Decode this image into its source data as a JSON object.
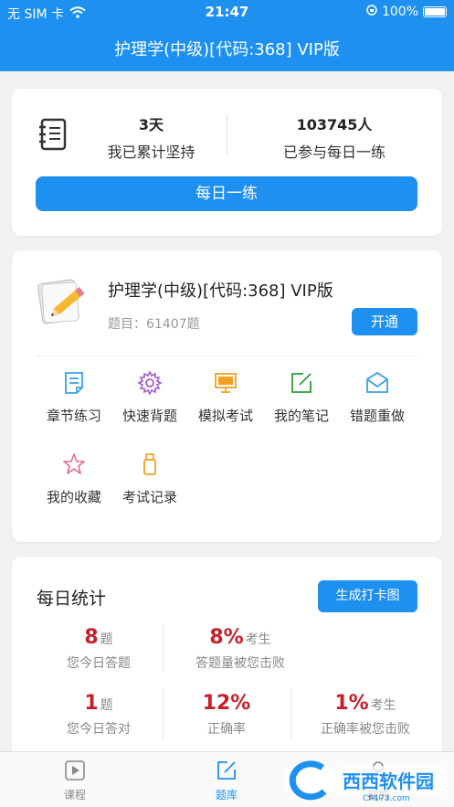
{
  "status_bar": {
    "carrier": "无 SIM 卡",
    "time": "21:47",
    "battery": "100%"
  },
  "header": {
    "title": "护理学(中级)[代码:368] VIP版"
  },
  "summary": {
    "days_value": "3天",
    "days_label": "我已累计坚持",
    "participants_value": "103745人",
    "participants_label": "已参与每日一练",
    "daily_button": "每日一练"
  },
  "course": {
    "name": "护理学(中级)[代码:368] VIP版",
    "question_count": "题目：61407题",
    "open_button": "开通"
  },
  "menu": {
    "chapter": "章节练习",
    "quick": "快速背题",
    "mock": "模拟考试",
    "notes": "我的笔记",
    "wrong": "错题重做",
    "favorites": "我的收藏",
    "records": "考试记录"
  },
  "daily_stats": {
    "title": "每日统计",
    "card_button": "生成打卡图",
    "answered_value": "8",
    "answered_unit": "题",
    "answered_label": "您今日答题",
    "beat_value": "8%",
    "beat_unit": "考生",
    "beat_label": "答题量被您击败",
    "correct_value": "1",
    "correct_unit": "题",
    "correct_label": "您今日答对",
    "accuracy_value": "12%",
    "accuracy_label": "正确率",
    "accuracy_beat_value": "1%",
    "accuracy_beat_unit": "考生",
    "accuracy_beat_label": "正确率被您击败"
  },
  "tabs": {
    "course": "课程",
    "bank": "题库",
    "mine": "我的"
  },
  "watermark": {
    "brand": "西西软件园",
    "url": "CR173.com"
  },
  "colors": {
    "primary": "#1e90ef",
    "highlight": "#c8202a"
  }
}
